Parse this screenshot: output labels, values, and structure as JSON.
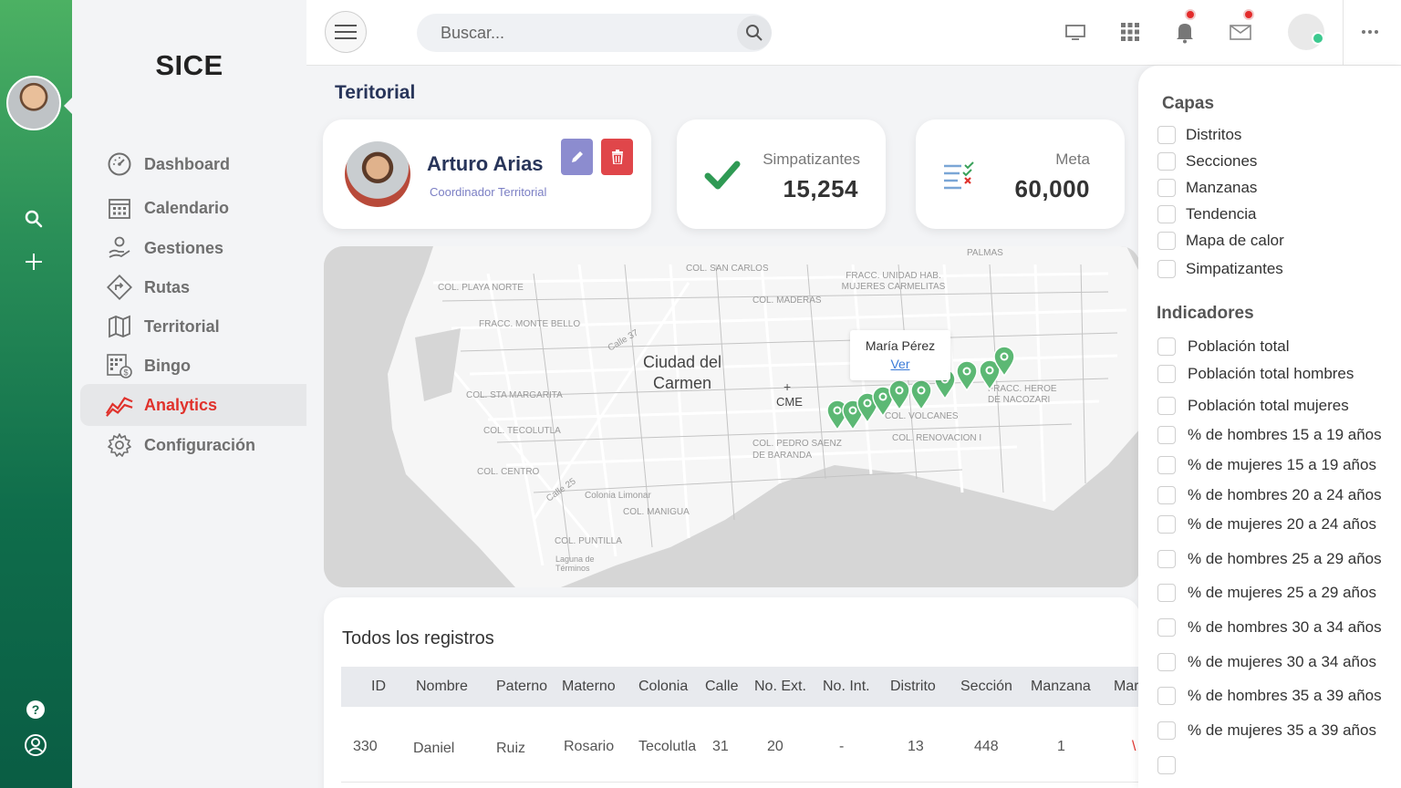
{
  "brand": "SICE",
  "menu": [
    {
      "label": "Dashboard",
      "icon": "dashboard-gauge-icon"
    },
    {
      "label": "Calendario",
      "icon": "calendar-icon"
    },
    {
      "label": "Gestiones",
      "icon": "hand-coin-icon"
    },
    {
      "label": "Rutas",
      "icon": "route-sign-icon"
    },
    {
      "label": "Territorial",
      "icon": "map-icon"
    },
    {
      "label": "Bingo",
      "icon": "bingo-card-icon"
    },
    {
      "label": "Analytics",
      "icon": "analytics-chart-icon",
      "active": true
    },
    {
      "label": "Configuración",
      "icon": "gear-icon"
    }
  ],
  "search": {
    "placeholder": "Buscar..."
  },
  "page_title": "Teritorial",
  "profile": {
    "name": "Arturo Arias",
    "role": "Coordinador Territorial"
  },
  "stats": [
    {
      "label": "Simpatizantes",
      "value": "15,254"
    },
    {
      "label": "Meta",
      "value": "60,000"
    }
  ],
  "map": {
    "city_label": "Ciudad del Carmen",
    "cme_label": "CME",
    "places": [
      "COL. PLAYA NORTE",
      "COL. SAN CARLOS",
      "FRACC. UNIDAD HAB. MUJERES CARMELITAS",
      "PALMAS",
      "COL. MADERAS",
      "FRACC. MONTE BELLO",
      "Calle 37",
      "COL. STA MARGARITA",
      "COL. TECOLUTLA",
      "COL. CENTRO",
      "Calle 25",
      "Colonia Limonar",
      "COL. MANIGUA",
      "COL. PUNTILLA",
      "Laguna de Términos",
      "COL. PEDRO SAENZ DE BARANDA",
      "COL. VOLCANES",
      "COL. RENOVACION I",
      "FRACC. HEROE DE NACOZARI"
    ],
    "popup": {
      "name": "María Pérez",
      "link": "Ver"
    },
    "marker_color": "#5cb874"
  },
  "records": {
    "title": "Todos los registros",
    "columns": [
      "ID",
      "Nombre",
      "Paterno",
      "Materno",
      "Colonia",
      "Calle",
      "No. Ext.",
      "No. Int.",
      "Distrito",
      "Sección",
      "Manzana",
      "Mar"
    ],
    "rows": [
      [
        "330",
        "Daniel",
        "Ruiz",
        "Rosario",
        "Tecolutla",
        "31",
        "20",
        "-",
        "13",
        "448",
        "1",
        "\\"
      ]
    ]
  },
  "layers": {
    "title": "Capas",
    "items": [
      "Distritos",
      "Secciones",
      "Manzanas",
      "Tendencia",
      "Mapa de calor",
      "Simpatizantes"
    ]
  },
  "indicators": {
    "title": "Indicadores",
    "items": [
      "Población total",
      "Población total hombres",
      "Población total mujeres",
      "% de hombres 15 a 19 años",
      "% de mujeres 15 a 19 años",
      "% de hombres 20 a 24 años",
      "% de mujeres 20 a 24 años",
      "% de hombres 25 a 29 años",
      "% de mujeres 25 a 29 años",
      "% de hombres 30 a 34 años",
      "% de mujeres 30 a 34 años",
      "% de hombres 35 a 39 años",
      "% de mujeres 35 a 39 años",
      ""
    ]
  },
  "colors": {
    "accent_red": "#e0322c",
    "sidebar_green": "#1f8a55",
    "edit_purple": "#8c8ccf",
    "delete_red": "#e0464a"
  }
}
